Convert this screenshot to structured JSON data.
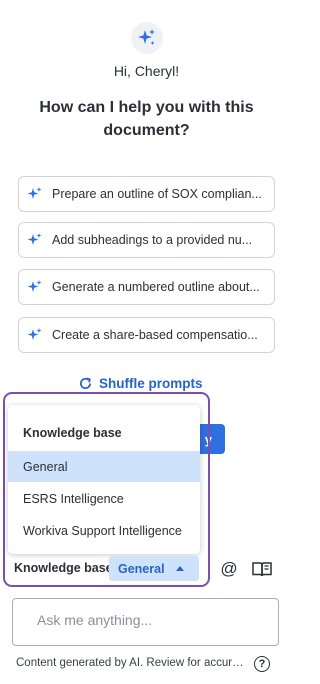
{
  "greeting": "Hi, Cheryl!",
  "headline": "How can I help you with this document?",
  "prompts": [
    {
      "label": "Prepare an outline of SOX complian..."
    },
    {
      "label": "Add subheadings to a provided nu..."
    },
    {
      "label": "Generate a numbered outline about..."
    },
    {
      "label": "Create a share-based compensatio..."
    }
  ],
  "shuffle_label": "Shuffle prompts",
  "hidden_button_fragment": "y",
  "knowledge_menu": {
    "header": "Knowledge base",
    "items": [
      "General",
      "ESRS Intelligence",
      "Workiva Support Intelligence"
    ],
    "selected": "General"
  },
  "toolbar": {
    "kb_label": "Knowledge base",
    "kb_value": "General",
    "mention_symbol": "@"
  },
  "input": {
    "placeholder": "Ask me anything...",
    "value": ""
  },
  "footer": {
    "disclaimer": "Content generated by AI. Review for accuracy.",
    "help_symbol": "?"
  },
  "colors": {
    "accent": "#2764c4",
    "button_blue": "#2f6fe0",
    "selected_bg": "#cfe2fb",
    "highlight_frame": "#7b4fb0"
  },
  "icons": [
    "sparkles-icon",
    "sparkle-icon",
    "refresh-icon",
    "caret-up-icon",
    "at-icon",
    "book-icon",
    "help-icon"
  ]
}
